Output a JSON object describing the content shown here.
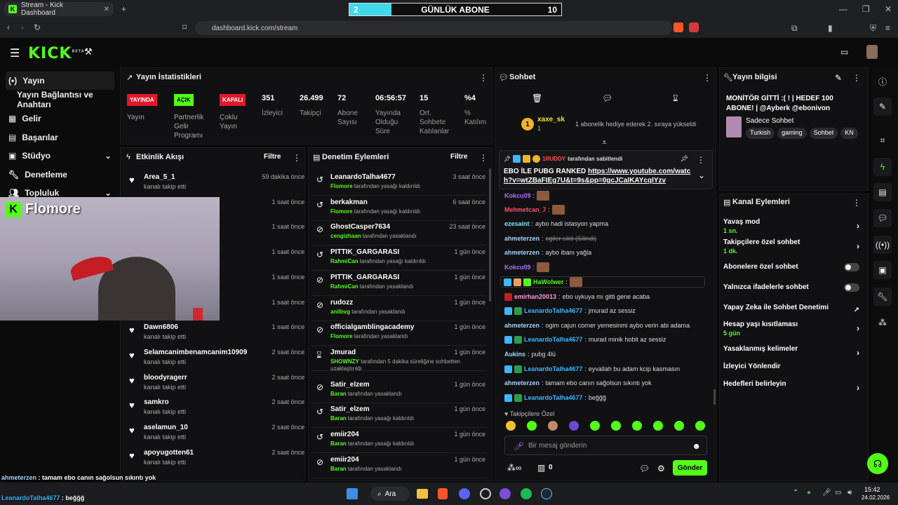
{
  "browser": {
    "tab_title": "Stream - Kick Dashboard",
    "url": "dashboard.kick.com/stream",
    "goal": {
      "current": "2",
      "label": "GÜNLÜK ABONE",
      "target": "10",
      "progress": 0.2
    }
  },
  "sidebar": {
    "items": [
      {
        "label": "Yayın"
      },
      {
        "label": "Yayın Bağlantısı ve Anahtarı"
      },
      {
        "label": "Gelir"
      },
      {
        "label": "Başarılar"
      },
      {
        "label": "Stüdyo"
      },
      {
        "label": "Denetleme"
      },
      {
        "label": "Topluluk"
      }
    ]
  },
  "stats": {
    "title": "Yayın İstatistikleri",
    "badges": [
      {
        "value": "YAYINDA",
        "label": "Yayın",
        "color": "#e0192b"
      },
      {
        "value": "AÇIK",
        "label": "Partnerlik Gelir Programı",
        "color": "#53fc18"
      },
      {
        "value": "KAPALI",
        "label": "Çoklu Yayın",
        "color": "#e0192b"
      }
    ],
    "metrics": [
      {
        "value": "351",
        "label": "İzleyici"
      },
      {
        "value": "26.499",
        "label": "Takipçi"
      },
      {
        "value": "72",
        "label": "Abone Sayısı"
      },
      {
        "value": "06:56:57",
        "label": "Yayında Olduğu Süre"
      },
      {
        "value": "15",
        "label": "Ort. Sohbete Katılanlar"
      },
      {
        "value": "%4",
        "label": "% Katılım"
      }
    ]
  },
  "activity": {
    "title": "Etkinlik Akışı",
    "filter": "Filtre",
    "rows": [
      {
        "name": "Area_5_1",
        "sub": "kanalı takip etti",
        "time": "59 dakika önce"
      },
      {
        "name": "",
        "sub": "",
        "time": "1 saat önce"
      },
      {
        "name": "",
        "sub": "",
        "time": "1 saat önce"
      },
      {
        "name": "",
        "sub": "",
        "time": "1 saat önce"
      },
      {
        "name": "",
        "sub": "",
        "time": "1 saat önce"
      },
      {
        "name": "",
        "sub": "",
        "time": "1 saat önce"
      },
      {
        "name": "Dawn6806",
        "sub": "kanalı takip etti",
        "time": "1 saat önce"
      },
      {
        "name": "Selamcanimbenamcanim10909",
        "sub": "kanalı takip etti",
        "time": "2 saat önce"
      },
      {
        "name": "bloodyragerr",
        "sub": "kanalı takip etti",
        "time": "2 saat önce"
      },
      {
        "name": "samkro",
        "sub": "kanalı takip etti",
        "time": "2 saat önce"
      },
      {
        "name": "aselamun_10",
        "sub": "kanalı takip etti",
        "time": "2 saat önce"
      },
      {
        "name": "apoyugotten61",
        "sub": "kanalı takip etti",
        "time": "2 saat önce"
      }
    ]
  },
  "moderation": {
    "title": "Denetim Eylemleri",
    "filter": "Filtre",
    "rows": [
      {
        "icon": "unban",
        "name": "LeanardoTalha4677",
        "actor": "Flomore",
        "action": "tarafından yasağı kaldırıldı",
        "time": "3 saat önce"
      },
      {
        "icon": "unban",
        "name": "berkakman",
        "actor": "Flomore",
        "action": "tarafından yasağı kaldırıldı",
        "time": "6 saat önce"
      },
      {
        "icon": "ban",
        "name": "GhostCasper7634",
        "actor": "cengizhaan",
        "action": "tarafından yasaklandı",
        "time": "23 saat önce"
      },
      {
        "icon": "unban",
        "name": "PITTIK_GARGARASI",
        "actor": "RahmiCan",
        "action": "tarafından yasağı kaldırıldı",
        "time": "1 gün önce"
      },
      {
        "icon": "ban",
        "name": "PITTIK_GARGARASI",
        "actor": "RahmiCan",
        "action": "tarafından yasaklandı",
        "time": "1 gün önce"
      },
      {
        "icon": "ban",
        "name": "rudozz",
        "actor": "anilbvg",
        "action": "tarafından yasaklandı",
        "time": "1 gün önce"
      },
      {
        "icon": "ban",
        "name": "officialgamblingacademy",
        "actor": "Flomore",
        "action": "tarafından yasaklandı",
        "time": "1 gün önce"
      },
      {
        "icon": "timeout",
        "name": "Jmurad",
        "actor": "SHOWNZY",
        "action": "tarafından 5 dakika süreliğine sohbetten uzaklaştırıldı",
        "time": "1 gün önce"
      },
      {
        "icon": "ban",
        "name": "Satir_elzem",
        "actor": "Baran",
        "action": "tarafından yasaklandı",
        "time": "1 gün önce"
      },
      {
        "icon": "unban",
        "name": "Satir_elzem",
        "actor": "Baran",
        "action": "tarafından yasağı kaldırıldı",
        "time": "1 gün önce"
      },
      {
        "icon": "unban",
        "name": "emiir204",
        "actor": "Baran",
        "action": "tarafından yasağı kaldırıldı",
        "time": "1 gün önce"
      },
      {
        "icon": "ban",
        "name": "emiir204",
        "actor": "Baran",
        "action": "tarafından yasaklandı",
        "time": "1 gün önce"
      }
    ]
  },
  "chat": {
    "title": "Sohbet",
    "top_gifter": {
      "name": "xaxe_sk",
      "count": "1",
      "rank": "1",
      "message": "1 abonelik hediye ederek 2. sıraya yükseldi"
    },
    "pinned": {
      "by": "1RUDDY",
      "by_suffix": "tarafından sabitlendi",
      "text": "EBO İLE PUBG RANKED ",
      "link": "https://www.youtube.com/watch?v=wtZBaFIEg7U&t=9s&pp=0gcJCaIKAYcqIYzv"
    },
    "messages": [
      {
        "user": "Kokcu09",
        "text": "",
        "color": "#b06cff",
        "emote": true
      },
      {
        "user": "Mehmetcan_7",
        "text": "",
        "color": "#ff4d6d",
        "emote": true
      },
      {
        "user": "ezesaint",
        "text": "aybo hadi istasyon yapma",
        "color": "#7ee6ff"
      },
      {
        "user": "ahmeterzen",
        "text": "ogiler sikti (Silindi)",
        "color": "#a4d4ff",
        "deleted": true
      },
      {
        "user": "ahmeterzen",
        "text": "aybo ibanı yağla",
        "color": "#a4d4ff"
      },
      {
        "user": "Kokcu09",
        "text": "",
        "color": "#b06cff",
        "emote": true
      },
      {
        "user": "HaWolwer",
        "text": "",
        "color": "#53fc18",
        "emote": true
      },
      {
        "user": "emirhan20013",
        "text": "ebo uykuya mı gitti gene acaba",
        "color": "#ff9ad5"
      },
      {
        "user": "LeanardoTalha4677",
        "text": "jmurad az sessiz",
        "color": "#3fb6ff"
      },
      {
        "user": "ahmeterzen",
        "text": "ogim cajun corner yemesinmi aybo verin abi adama",
        "color": "#a4d4ff"
      },
      {
        "user": "LeanardoTalha4677",
        "text": "murad minik hobit az sessiz",
        "color": "#3fb6ff"
      },
      {
        "user": "Aukins",
        "text": "pubg 4lü",
        "color": "#a4d4ff"
      },
      {
        "user": "LeanardoTalha4677",
        "text": "eyvallah bu adam kcip kasmasın",
        "color": "#3fb6ff"
      },
      {
        "user": "ahmeterzen",
        "text": "tamam ebo canın sağolsun sıkıntı yok",
        "color": "#a4d4ff"
      },
      {
        "user": "LeanardoTalha4677",
        "text": "beğğğ",
        "color": "#3fb6ff"
      }
    ],
    "followers_only": "Takipçilere Özel",
    "input_placeholder": "Bir mesaj gönderin",
    "send_label": "Gönder",
    "points": "0"
  },
  "stream_info": {
    "title": "Yayın bilgisi",
    "stream_title": "MONİTÖR GİTTİ :( ! | HEDEF 100 ABONE! | @Ayberk @ebonivon",
    "category": "Sadece Sohbet",
    "tags": [
      "Turkish",
      "gaming",
      "Sohbet",
      "KN"
    ]
  },
  "channel_actions": {
    "title": "Kanal Eylemleri",
    "rows": [
      {
        "label": "Yavaş mod",
        "sub": "1 sn.",
        "kind": "chevron"
      },
      {
        "label": "Takipçilere özel sohbet",
        "sub": "1 dk.",
        "kind": "chevron"
      },
      {
        "label": "Abonelere özel sohbet",
        "sub": "",
        "kind": "toggle"
      },
      {
        "label": "Yalnızca ifadelerle sohbet",
        "sub": "",
        "kind": "toggle"
      },
      {
        "label": "Yapay Zeka ile Sohbet Denetimi",
        "sub": "",
        "kind": "external"
      },
      {
        "label": "Hesap yaşı kısıtlaması",
        "sub": "5 gün",
        "kind": "chevron"
      },
      {
        "label": "Yasaklanmış kelimeler",
        "sub": "",
        "kind": "chevron"
      },
      {
        "label": "İzleyici Yönlendir",
        "sub": "",
        "kind": "none"
      },
      {
        "label": "Hedefleri belirleyin",
        "sub": "",
        "kind": "chevron"
      }
    ]
  },
  "overlay": {
    "webcam_name": "Flomore",
    "chat_lines": [
      {
        "user": "ahmeterzen",
        "text": " : tamam ebo canın sağolsun sıkıntı yok"
      },
      {
        "user": "LeanardoTalha4677",
        "text": " : beğğğ"
      }
    ]
  },
  "taskbar": {
    "search": "Ara",
    "time": "15:42",
    "date": "24.02.2026"
  },
  "colors": {
    "accent": "#53fc18",
    "live": "#e0192b"
  }
}
